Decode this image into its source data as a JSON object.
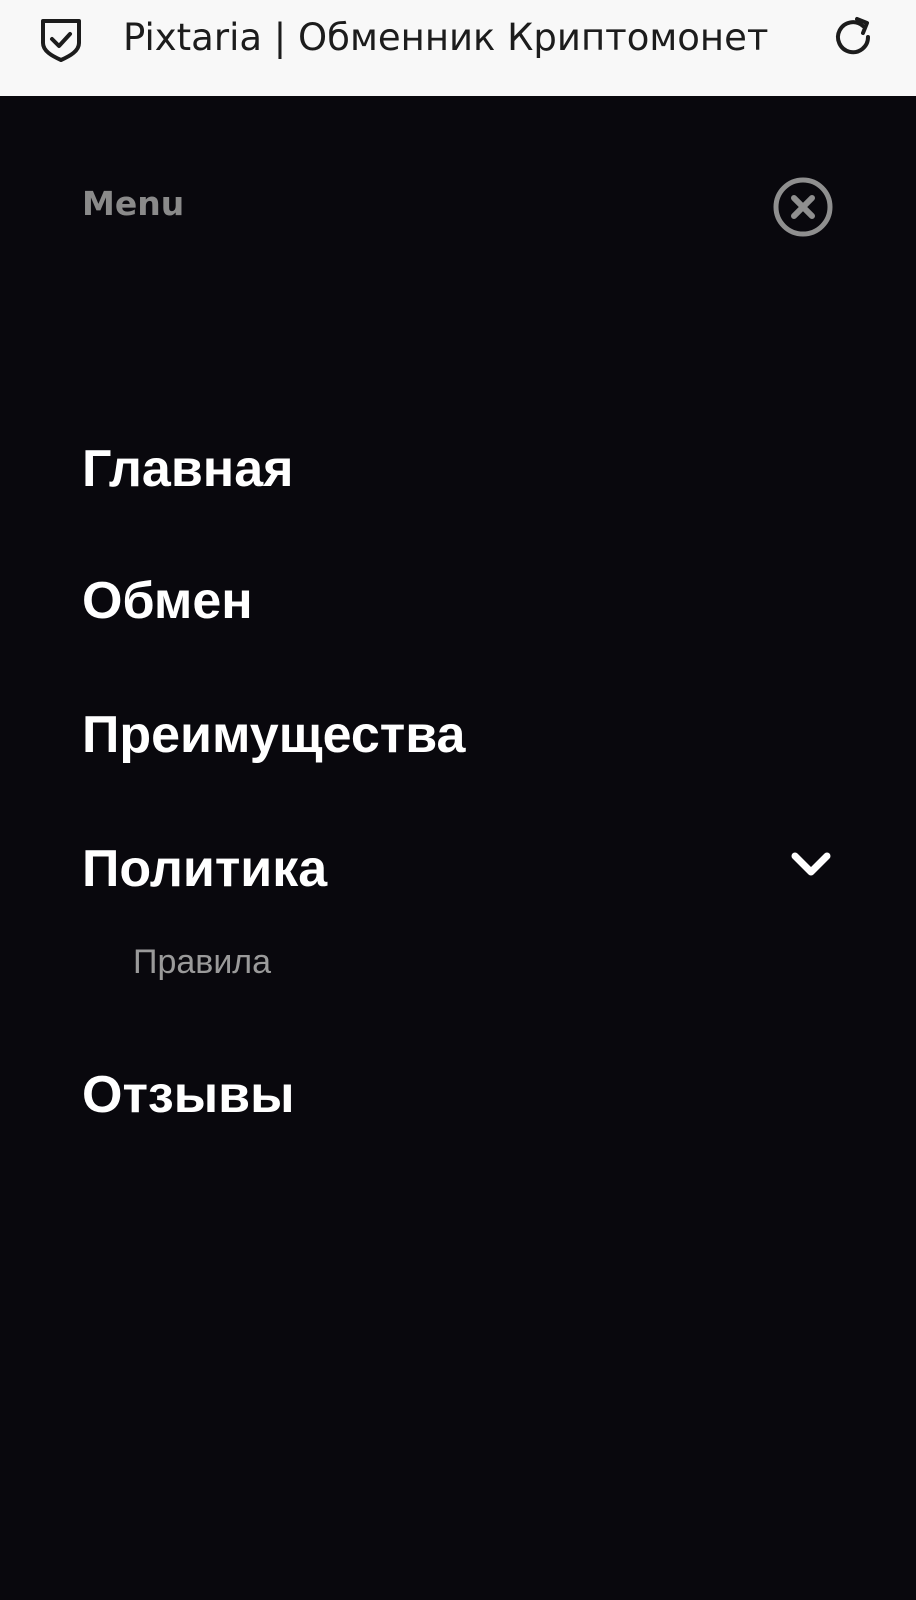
{
  "browser": {
    "tab_title": "Pixtaria | Обменник Криптомонет",
    "security_icon": "shield-check-icon",
    "reload_icon": "reload-icon"
  },
  "menu": {
    "label": "Menu",
    "close_icon": "close-circle-icon",
    "items": [
      {
        "label": "Главная"
      },
      {
        "label": "Обмен"
      },
      {
        "label": "Преимущества"
      },
      {
        "label": "Политика",
        "expand_icon": "chevron-down-icon",
        "expanded": true,
        "children": [
          {
            "label": "Правила"
          }
        ]
      },
      {
        "label": "Отзывы"
      }
    ]
  },
  "colors": {
    "background": "#09080d",
    "topbar": "#f8f8f8",
    "item_text": "#ffffff",
    "muted_text": "#8a8a8a"
  }
}
